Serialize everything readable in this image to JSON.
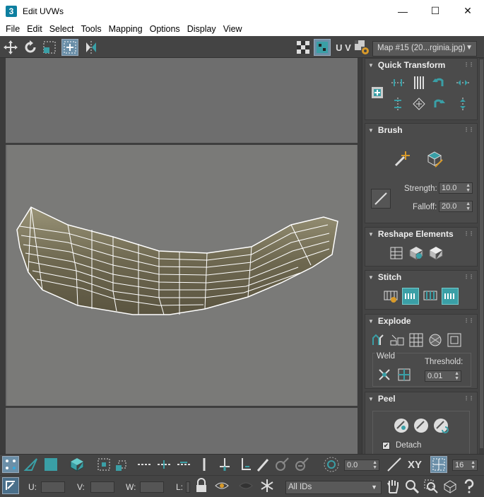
{
  "window": {
    "title": "Edit UVWs",
    "app_icon": "3",
    "minimize": "—",
    "maximize": "☐",
    "close": "✕"
  },
  "menu": [
    "File",
    "Edit",
    "Select",
    "Tools",
    "Mapping",
    "Options",
    "Display",
    "View"
  ],
  "toolbar": {
    "uv_label": "U V",
    "map_select": "Map #15 (20...rginia.jpg)"
  },
  "panel": {
    "quick_transform": "Quick Transform",
    "brush": "Brush",
    "strength_label": "Strength:",
    "strength_value": "10.0",
    "falloff_label": "Falloff:",
    "falloff_value": "20.0",
    "reshape": "Reshape Elements",
    "stitch": "Stitch",
    "explode": "Explode",
    "weld": "Weld",
    "threshold_label": "Threshold:",
    "threshold_value": "0.01",
    "peel": "Peel",
    "detach": "Detach"
  },
  "bottom": {
    "angle_value": "0.0",
    "xy_label": "XY",
    "grid_value": "16",
    "u_label": "U:",
    "v_label": "V:",
    "w_label": "W:",
    "l_label": "L:",
    "ids_select": "All IDs"
  },
  "colors": {
    "accent": "#3a9fa6",
    "bg": "#444444",
    "banana": "#6a6450"
  }
}
